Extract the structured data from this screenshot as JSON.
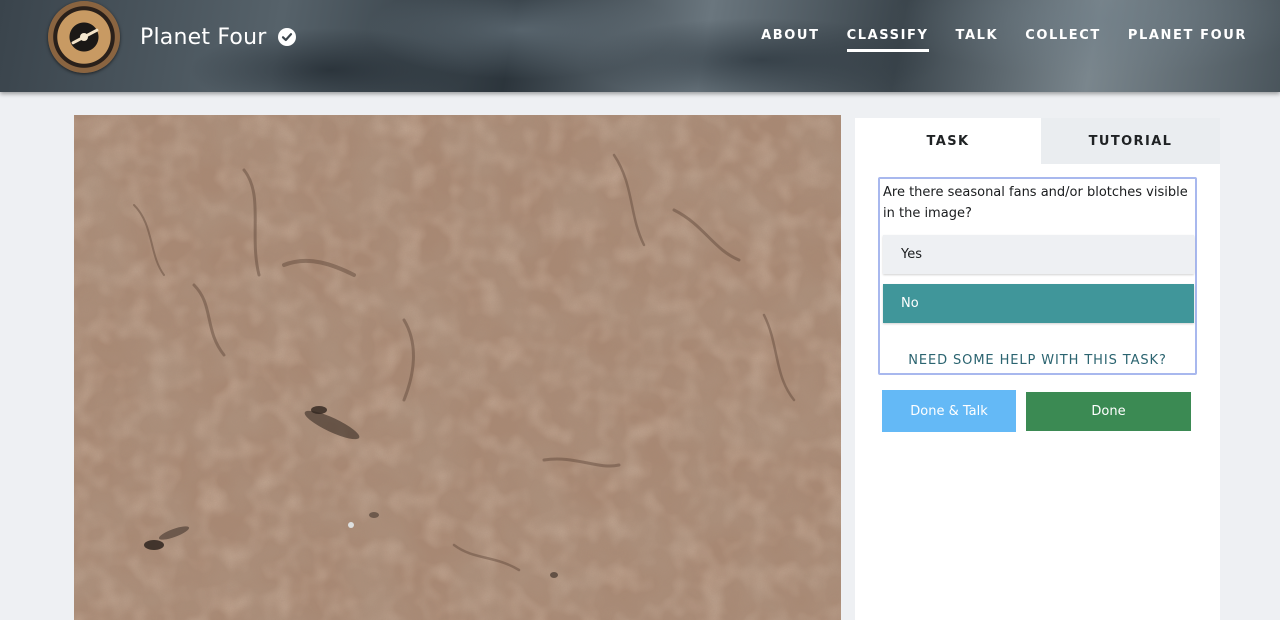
{
  "header": {
    "project_name": "Planet Four",
    "nav": [
      {
        "label": "ABOUT"
      },
      {
        "label": "CLASSIFY",
        "active": true
      },
      {
        "label": "TALK"
      },
      {
        "label": "COLLECT"
      },
      {
        "label": "PLANET FOUR"
      }
    ]
  },
  "panel": {
    "tabs": {
      "task": "TASK",
      "tutorial": "TUTORIAL"
    },
    "question": "Are there seasonal fans and/or blotches visible in the image?",
    "answers": [
      {
        "label": "Yes",
        "selected": false
      },
      {
        "label": "No",
        "selected": true
      }
    ],
    "help_link": "NEED SOME HELP WITH THIS TASK?",
    "buttons": {
      "done_talk": "Done & Talk",
      "done": "Done"
    }
  },
  "colors": {
    "selected_answer": "#40969a",
    "done_talk_button": "#64b9f6",
    "done_button": "#3b8a53",
    "question_border": "#a8b8ee"
  },
  "icons": {
    "verified": "check-circle",
    "logo": "planet-four-logo"
  }
}
